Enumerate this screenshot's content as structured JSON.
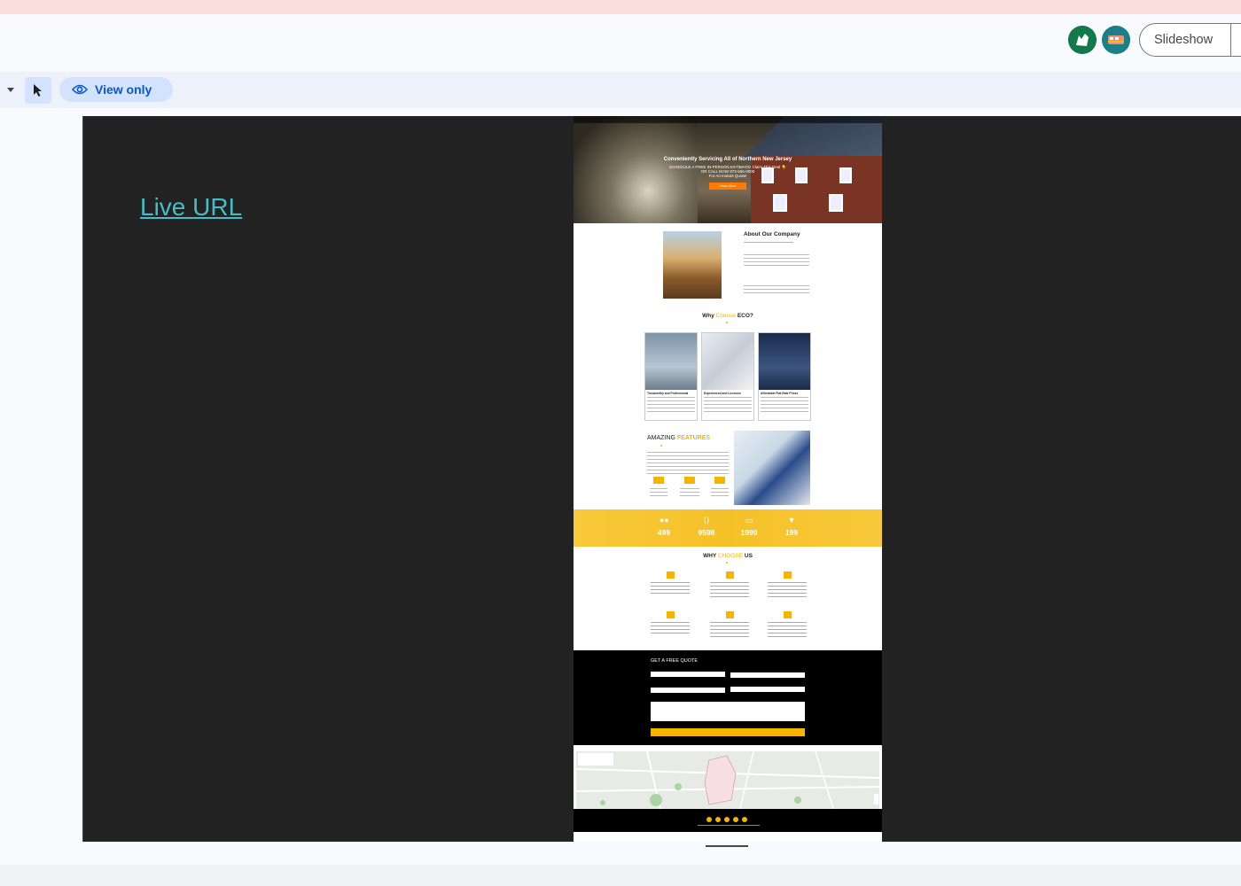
{
  "header": {
    "slideshow_label": "Slideshow",
    "avatars": [
      {
        "name": "collaborator-avatar-1",
        "color": "#13794a"
      },
      {
        "name": "collaborator-avatar-2",
        "color": "#1a7f86"
      }
    ]
  },
  "toolbar": {
    "mode_label": "View only",
    "select_tool_icon": "cursor-arrow-icon",
    "mode_icon": "eye-icon"
  },
  "slide": {
    "link_text": "Live URL",
    "link_color": "#46bdc6",
    "background": "#222222"
  },
  "website_preview": {
    "hero_title": "Conveniently Servicing All of Northern New Jersey",
    "hero_sub_1": "SCHEDULE A FREE IN-PERSON ESTIMATE! Claim This Deal 👇",
    "hero_sub_2": "OR CALL NOW 973-555-0000",
    "hero_sub_3": "For An Instant Quote!",
    "hero_button": "Learn More",
    "about_title": "About Our Company",
    "why_title_pre": "Why ",
    "why_title_hl": "Choose",
    "why_title_post": " ECO?",
    "cards": [
      {
        "title": "Trustworthy and Professional"
      },
      {
        "title": "Experienced and Licensed"
      },
      {
        "title": "Affordable Flat-Rate Prices"
      }
    ],
    "features_pre": "AMAZING ",
    "features_hl": "FEATURES",
    "stats": [
      "499",
      "9598",
      "1999",
      "199"
    ],
    "why2_pre": "WHY ",
    "why2_hl": "CHOOSE",
    "why2_post": " US",
    "quote_title": "GET A FREE QUOTE",
    "accent": "#f4b400"
  }
}
